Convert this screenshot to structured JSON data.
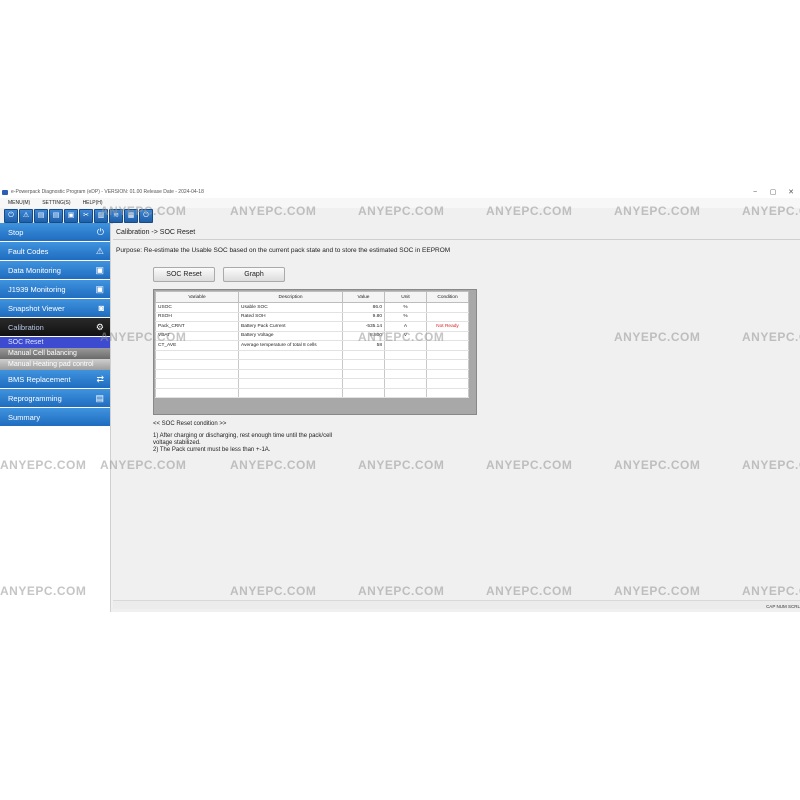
{
  "window": {
    "title": "e-Powerpack Diagnostic Program (eDP) - VERSION: 01.00 Release Date - 2024-04-18",
    "min": "−",
    "max": "▢",
    "close": "✕"
  },
  "menu": [
    "MENU(M)",
    "SETTING(S)",
    "HELP(H)"
  ],
  "toolbar_icons": [
    "⏻",
    "⚠",
    "▤",
    "▤",
    "▣",
    "✂",
    "▥",
    "≋",
    "▦",
    "⏻"
  ],
  "sidebar": {
    "stop": "Stop",
    "fault_codes": "Fault Codes",
    "data_monitoring": "Data Monitoring",
    "j1939_monitoring": "J1939 Monitoring",
    "snapshot_viewer": "Snapshot Viewer",
    "calibration": "Calibration",
    "soc_reset": "SOC Reset",
    "manual_cell_balancing": "Manual Cell balancing",
    "manual_heating_pad": "Manual Heating pad control",
    "bms_replacement": "BMS Replacement",
    "reprogramming": "Reprogramming",
    "summary": "Summary"
  },
  "main": {
    "breadcrumb": "Calibration -> SOC Reset",
    "purpose": "Purpose: Re-estimate the Usable SOC based on the current pack state and to store the estimated SOC in EEPROM",
    "soc_reset_button": "SOC Reset",
    "graph_button": "Graph",
    "table": {
      "headers": [
        "Variable",
        "Description",
        "Value",
        "Unit",
        "Condition"
      ],
      "rows": [
        [
          "USOC",
          "Usable SOC",
          "86.0",
          "%",
          ""
        ],
        [
          "RSOH",
          "Rated SOH",
          "9.80",
          "%",
          ""
        ],
        [
          "Pack_CRNT",
          "Battery Pack Current",
          "-535.14",
          "A",
          "Not Ready"
        ],
        [
          "VBAT",
          "Battery Voltage",
          "8.800",
          "V",
          ""
        ],
        [
          "CT_AVE",
          "Average temperature of total 8 cells",
          "58",
          "",
          ""
        ]
      ]
    },
    "condition_title": "<< SOC Reset condition >>",
    "condition_1": "1) After charging or discharging,  rest enough time until the pack/cell",
    "condition_1b": "voltage stabilized.",
    "condition_2": "2) The Pack current must be less than +-1A."
  },
  "status": "CAP  NUM  SCRL",
  "watermark": "ANYEPC.COM",
  "watermark_logo": "AE",
  "colors": {
    "nav_blue": "#2f80d0",
    "active_sub": "#3c4bd0",
    "not_ready": "#d81f1f"
  }
}
